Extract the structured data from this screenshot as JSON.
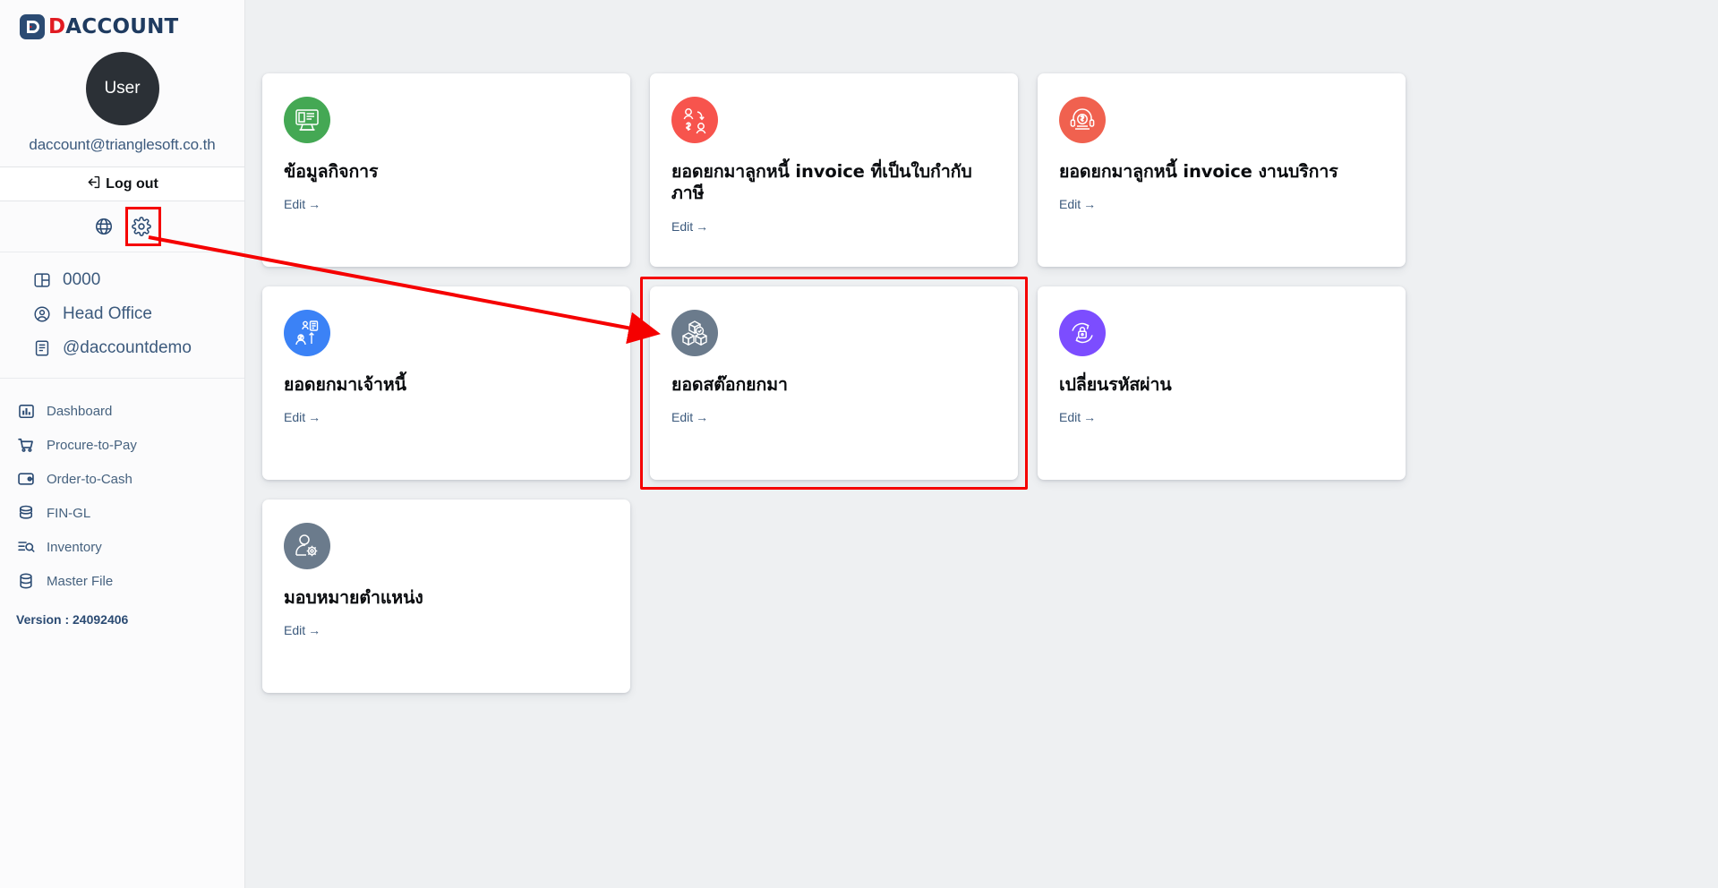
{
  "brand": {
    "logo_d": "D",
    "logo_rest": "ACCOUNT",
    "logo_icon": "logo-d-mark-icon"
  },
  "sidebar": {
    "avatar_label": "User",
    "user_email": "daccount@trianglesoft.co.th",
    "logout_label": "Log out",
    "logout_icon": "logout-icon",
    "quick_icons": [
      {
        "name": "globe-icon",
        "label": "Language"
      },
      {
        "name": "gear-icon",
        "label": "Settings"
      }
    ],
    "org_items": [
      {
        "label": "0000",
        "icon": "company-panel-icon"
      },
      {
        "label": "Head Office",
        "icon": "user-circle-icon"
      },
      {
        "label": "@daccountdemo",
        "icon": "document-icon"
      }
    ],
    "nav_items": [
      {
        "label": "Dashboard",
        "icon": "bar-chart-icon"
      },
      {
        "label": "Procure-to-Pay",
        "icon": "shopping-cart-icon"
      },
      {
        "label": "Order-to-Cash",
        "icon": "wallet-icon"
      },
      {
        "label": "FIN-GL",
        "icon": "coins-stack-icon"
      },
      {
        "label": "Inventory",
        "icon": "list-search-icon"
      },
      {
        "label": "Master File",
        "icon": "database-icon"
      }
    ],
    "version_label": "Version : 24092406"
  },
  "main": {
    "edit_label": "Edit",
    "edit_arrow": "→",
    "cards": [
      {
        "title": "ข้อมูลกิจการ",
        "icon": "business-info-monitor-icon",
        "color": "#44a854",
        "selected": false
      },
      {
        "title": "ยอดยกมาลูกหนี้ invoice ที่เป็นใบกำกับภาษี",
        "icon": "receivable-transfer-icon",
        "color": "#f7544d",
        "selected": false
      },
      {
        "title": "ยอดยกมาลูกหนี้ invoice งานบริการ",
        "icon": "service-receivable-icon",
        "color": "#f0614f",
        "selected": false
      },
      {
        "title": "ยอดยกมาเจ้าหนี้",
        "icon": "payable-transfer-icon",
        "color": "#3b82f6",
        "selected": false
      },
      {
        "title": "ยอดสต๊อกยกมา",
        "icon": "stock-boxes-icon",
        "color": "#6b7b8c",
        "selected": true
      },
      {
        "title": "เปลี่ยนรหัสผ่าน",
        "icon": "change-password-lock-icon",
        "color": "#7c4dff",
        "selected": false
      },
      {
        "title": "มอบหมายตำแหน่ง",
        "icon": "assign-role-icon",
        "color": "#6b7b8c",
        "selected": false
      }
    ]
  },
  "annotation": {
    "highlight_color": "#f50000",
    "arrow_from": "gear-icon",
    "arrow_to": "card-stock-yokma"
  }
}
